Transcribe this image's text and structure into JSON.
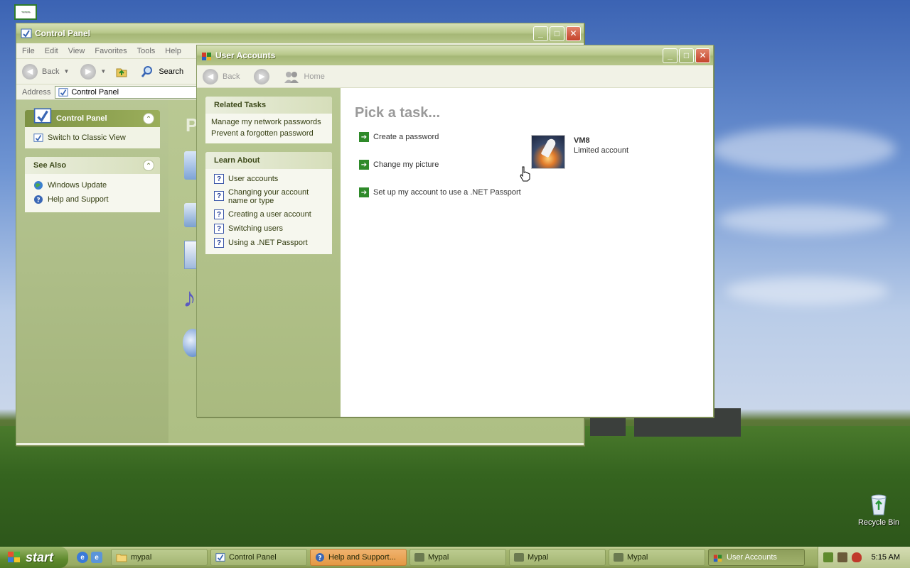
{
  "desktop": {
    "icons": [
      {
        "label": "",
        "icon": "mypal-app-icon"
      },
      {
        "label": "Recycle Bin",
        "icon": "recycle-bin-icon"
      }
    ]
  },
  "control_panel": {
    "title": "Control Panel",
    "menu": [
      "File",
      "Edit",
      "View",
      "Favorites",
      "Tools",
      "Help"
    ],
    "toolbar": {
      "back": "Back",
      "search": "Search"
    },
    "address": {
      "label": "Address",
      "value": "Control Panel"
    },
    "side": {
      "panel_title": "Control Panel",
      "switch_view": "Switch to Classic View",
      "see_also_title": "See Also",
      "see_also_items": [
        "Windows Update",
        "Help and Support"
      ]
    },
    "main_heading_partial": "P"
  },
  "user_accounts": {
    "title": "User Accounts",
    "toolbar": {
      "back": "Back",
      "home": "Home"
    },
    "related_tasks": {
      "title": "Related Tasks",
      "items": [
        "Manage my network passwords",
        "Prevent a forgotten password"
      ]
    },
    "learn_about": {
      "title": "Learn About",
      "items": [
        "User accounts",
        "Changing your account name or type",
        "Creating a user account",
        "Switching users",
        "Using a .NET Passport"
      ]
    },
    "heading": "Pick a task...",
    "tasks": [
      "Create a password",
      "Change my picture",
      "Set up my account to use a .NET Passport"
    ],
    "account": {
      "name": "VM8",
      "type": "Limited account"
    }
  },
  "taskbar": {
    "start": "start",
    "buttons": [
      {
        "label": "mypal",
        "icon": "folder-icon"
      },
      {
        "label": "Control Panel",
        "icon": "control-panel-icon"
      },
      {
        "label": "Help and Support...",
        "icon": "help-icon"
      },
      {
        "label": "Mypal",
        "icon": "mypal-icon"
      },
      {
        "label": "Mypal",
        "icon": "mypal-icon"
      },
      {
        "label": "Mypal",
        "icon": "mypal-icon"
      },
      {
        "label": "User Accounts",
        "icon": "user-accounts-icon"
      }
    ],
    "clock": "5:15 AM"
  },
  "colors": {
    "accent": "#8a9c63",
    "link_green": "#2f8a2a",
    "heading_gray": "#9a9a9a"
  }
}
